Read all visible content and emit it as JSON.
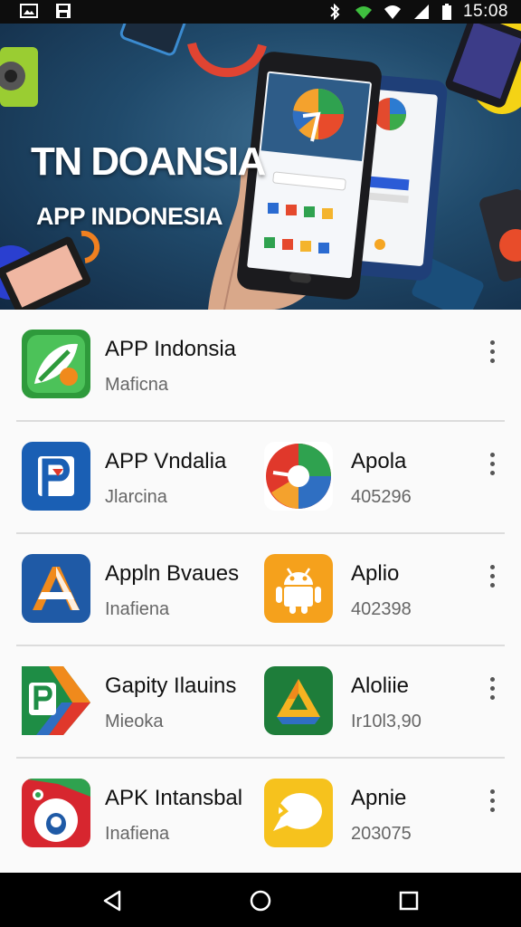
{
  "status_bar": {
    "time": "15:08"
  },
  "banner": {
    "title": "TN DOANSIA",
    "subtitle": "APP INDONESIA"
  },
  "apps": [
    {
      "name": "APP Indonsia",
      "subtitle": "Maficna",
      "icon": "leaf-check-icon",
      "color": "#2e9a3b"
    },
    {
      "name": "APP Vndalia",
      "subtitle": "Jlarcina",
      "icon": "p-letter-icon",
      "color": "#1a5fb4"
    },
    {
      "name": "Apola",
      "subtitle": "405296",
      "icon": "pie-wheel-icon",
      "color": "#e0382b"
    },
    {
      "name": "Appln Bvaues",
      "subtitle": "Inafiena",
      "icon": "a-letter-icon",
      "color": "#1f5aa6"
    },
    {
      "name": "Aplio",
      "subtitle": "402398",
      "icon": "android-icon",
      "color": "#f5a11c"
    },
    {
      "name": "Gapity Ilauins",
      "subtitle": "Mieoka",
      "icon": "p-arrow-icon",
      "color": "#1e8d45"
    },
    {
      "name": "Aloliie",
      "subtitle": "Ir10l3,90",
      "icon": "triangle-drive-icon",
      "color": "#1e7d3a"
    },
    {
      "name": "APK Intansbal",
      "subtitle": "Inafiena",
      "icon": "face-icon",
      "color": "#d7262f"
    },
    {
      "name": "Apnie",
      "subtitle": "203075",
      "icon": "chat-bubble-icon",
      "color": "#f6c21d"
    }
  ]
}
